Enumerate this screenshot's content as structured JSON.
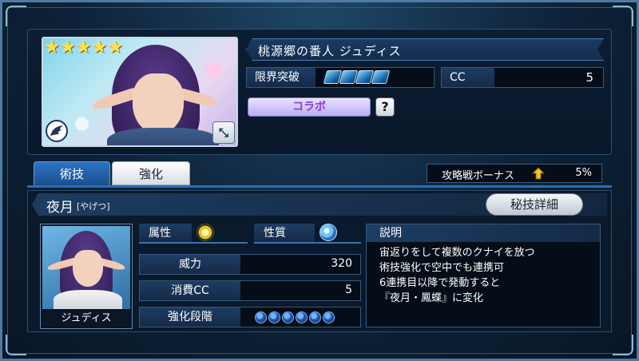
{
  "character": {
    "title": "桃源郷の番人 ジュディス",
    "stars": [
      "★",
      "★",
      "★",
      "★",
      "★"
    ],
    "short_name": "ジュディス",
    "portrait_icon": "judith-portrait",
    "wing_icon": "wing-icon",
    "expand_icon": "⤡"
  },
  "stats": {
    "limit_break_label": "限界突破",
    "limit_break_gems": 4,
    "cc_label": "CC",
    "cc_value": "5"
  },
  "collab_label": "コラボ",
  "help_label": "?",
  "tabs": [
    {
      "label": "術技",
      "active": true
    },
    {
      "label": "強化",
      "active": false
    }
  ],
  "bonus": {
    "label": "攻略戦ボーナス",
    "icon": "arrow-up-icon",
    "value": "5%"
  },
  "skill": {
    "name": "夜月",
    "reading": "[やげつ]",
    "secret_button": "秘技詳細",
    "attribute_label": "属性",
    "attribute_icon": "light-element-icon",
    "nature_label": "性質",
    "nature_icon": "water-swirl-icon",
    "power_label": "威力",
    "power_value": "320",
    "cc_cost_label": "消費CC",
    "cc_cost_value": "5",
    "enhance_label": "強化段階",
    "enhance_dots": 6,
    "desc_title": "説明",
    "description": "宙返りをして複数のクナイを放つ\n術技強化で空中でも連携可\n6連携目以降で発動すると\n『夜月・鳳蝶』に変化"
  },
  "colors": {
    "accent": "#2b6cb3",
    "star": "#ffe14b",
    "collab_text": "#8a3fd9"
  }
}
